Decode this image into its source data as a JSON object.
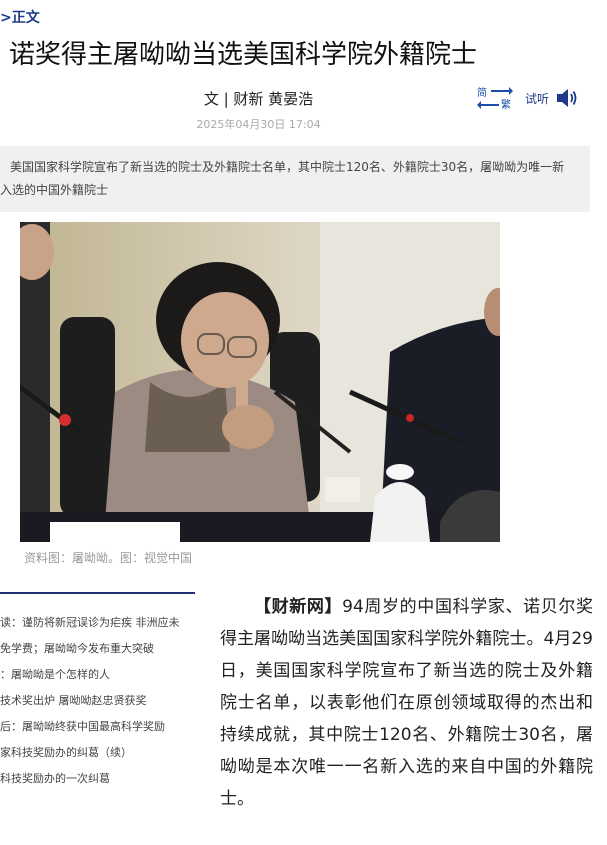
{
  "breadcrumb": {
    "separator": ">",
    "current": "正文"
  },
  "article": {
    "title": "诺奖得主屠呦呦当选美国科学院外籍院士",
    "byline": "文 | 财新 黄晏浩",
    "date": "2025年04月30日 17:04",
    "summary": "美国国家科学院宣布了新当选的院士及外籍院士名单，其中院士120名、外籍院士30名，屠呦呦为唯一新入选的中国外籍院士",
    "image_caption": "资料图：屠呦呦。图：视觉中国",
    "source_tag": "【财新网】",
    "body": "94周岁的中国科学家、诺贝尔奖得主屠呦呦当选美国国家科学院外籍院士。4月29日，美国国家科学院宣布了新当选的院士及外籍院士名单，以表彰他们在原创领域取得的杰出和持续成就，其中院士120名、外籍院士30名，屠呦呦是本次唯一一名新入选的来自中国的外籍院士。"
  },
  "tools": {
    "simplified": "简",
    "traditional": "繁",
    "listen_label": "试听"
  },
  "sidebar": {
    "items": [
      {
        "label": "读：谨防将新冠误诊为疟疾 非洲应未"
      },
      {
        "label": "免学费；屠呦呦今发布重大突破"
      },
      {
        "label": "：屠呦呦是个怎样的人"
      },
      {
        "label": "技术奖出炉 屠呦呦赵忠贤获奖"
      },
      {
        "label": "后：屠呦呦终获中国最高科学奖励"
      },
      {
        "label": "家科技奖励办的纠葛（续）"
      },
      {
        "label": "科技奖励办的一次纠葛"
      }
    ]
  },
  "colors": {
    "accent": "#1d3a8a",
    "summary_bg": "#f0f0f0"
  }
}
